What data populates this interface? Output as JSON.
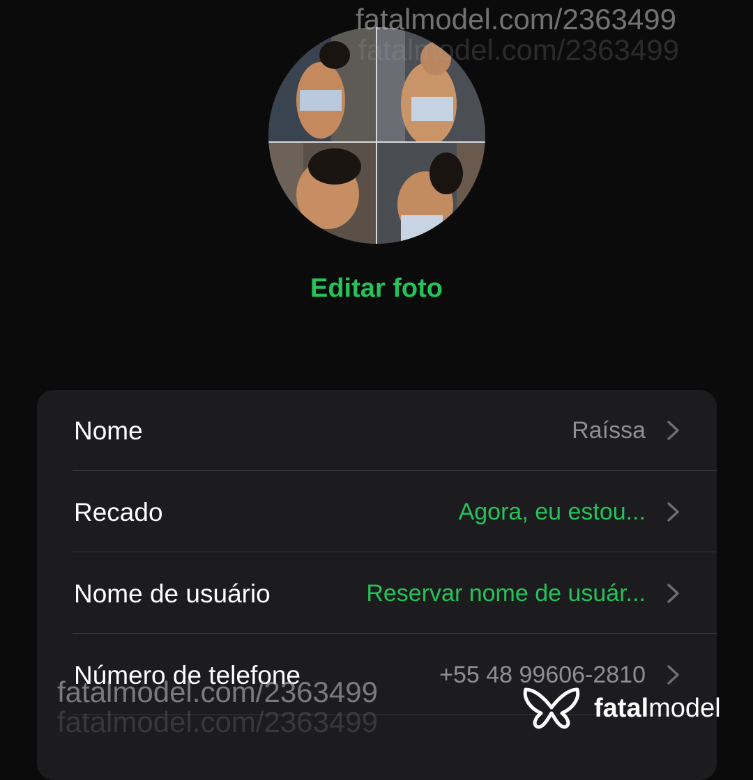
{
  "profile": {
    "edit_photo_label": "Editar foto"
  },
  "rows": [
    {
      "label": "Nome",
      "value": "Raíssa"
    },
    {
      "label": "Recado",
      "value": "Agora, eu estou..."
    },
    {
      "label": "Nome de usuário",
      "value": "Reservar nome de usuár..."
    },
    {
      "label": "Número de telefone",
      "value": "+55 48 99606-2810"
    }
  ],
  "watermark": {
    "text": "fatalmodel.com/2363499",
    "brand_bold": "fatal",
    "brand_light": "model"
  },
  "colors": {
    "accent": "#25c25a",
    "background": "#0b0b0b",
    "card": "#1c1c1e",
    "secondary_text": "#8e8e93"
  },
  "icons": {
    "row_chevron": "chevron-right-icon",
    "brand_logo": "fatalmodel-logo-icon"
  }
}
